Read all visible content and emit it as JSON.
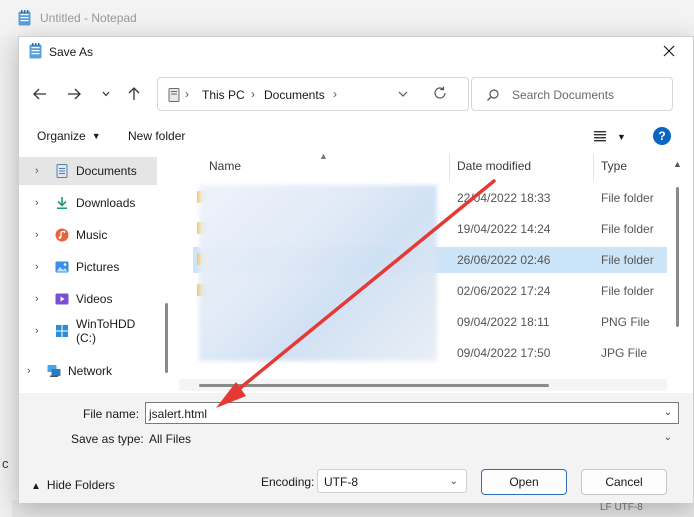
{
  "notepad": {
    "title": "Untitled - Notepad",
    "status_text": "LF  UTF-8",
    "edge_char": "c"
  },
  "dialog": {
    "title": "Save As",
    "address": {
      "segments": [
        "This PC",
        "Documents"
      ]
    },
    "search": {
      "placeholder": "Search Documents"
    },
    "toolbar": {
      "organize": "Organize",
      "new_folder": "New folder",
      "help": "?"
    },
    "sidebar": {
      "items": [
        {
          "label": "Documents",
          "icon": "documents-icon",
          "selected": true
        },
        {
          "label": "Downloads",
          "icon": "download-icon",
          "selected": false
        },
        {
          "label": "Music",
          "icon": "music-icon",
          "selected": false
        },
        {
          "label": "Pictures",
          "icon": "pictures-icon",
          "selected": false
        },
        {
          "label": "Videos",
          "icon": "videos-icon",
          "selected": false
        },
        {
          "label": "WinToHDD (C:)",
          "icon": "drive-icon",
          "selected": false
        },
        {
          "label": "Network",
          "icon": "network-icon",
          "selected": false
        }
      ]
    },
    "columns": {
      "name": "Name",
      "date": "Date modified",
      "type": "Type"
    },
    "rows": [
      {
        "date": "22/04/2022 18:33",
        "type": "File folder",
        "folder": true
      },
      {
        "date": "19/04/2022 14:24",
        "type": "File folder",
        "folder": true
      },
      {
        "date": "26/06/2022 02:46",
        "type": "File folder",
        "folder": true,
        "highlight": true
      },
      {
        "date": "02/06/2022 17:24",
        "type": "File folder",
        "folder": true
      },
      {
        "date": "09/04/2022 18:11",
        "type": "PNG File",
        "folder": false
      },
      {
        "date": "09/04/2022 17:50",
        "type": "JPG File",
        "folder": false
      }
    ],
    "form": {
      "file_name_label": "File name:",
      "file_name_value": "jsalert.html",
      "save_type_label": "Save as type:",
      "save_type_value": "All Files",
      "encoding_label": "Encoding:",
      "encoding_value": "UTF-8",
      "hide_folders": "Hide Folders",
      "open": "Open",
      "cancel": "Cancel"
    }
  },
  "colors": {
    "accent": "#0a66c2",
    "selection": "#cce4f7",
    "annotation": "#e53935"
  }
}
